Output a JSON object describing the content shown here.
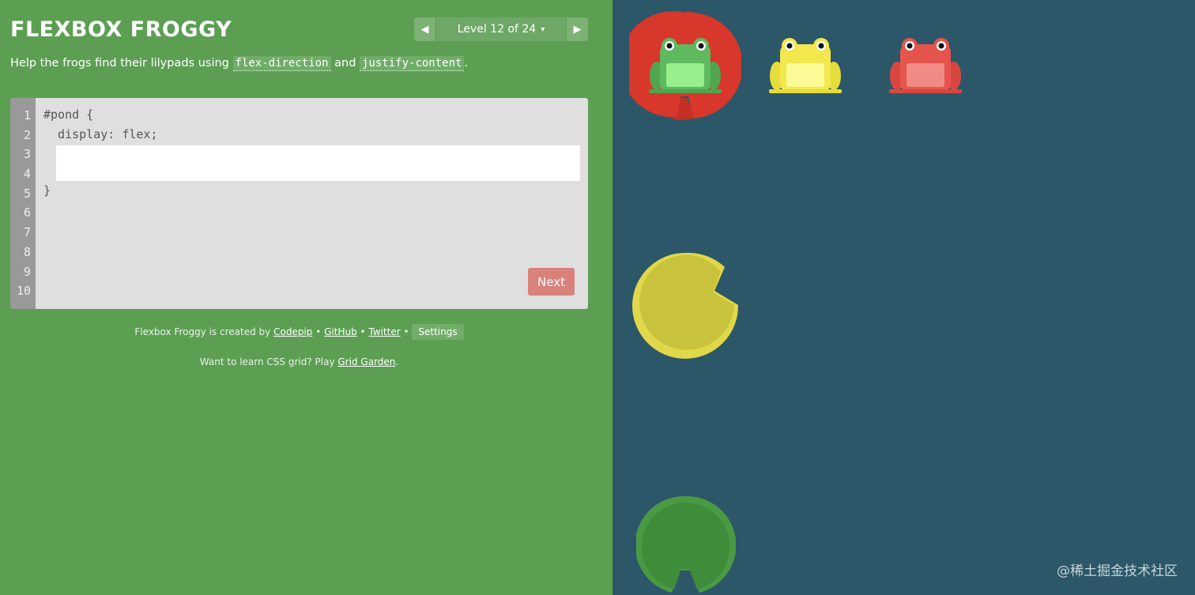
{
  "app": {
    "title": "FLEXBOX FROGGY"
  },
  "level_nav": {
    "prev_icon": "◀",
    "label": "Level 12 of 24",
    "caret_icon": "▾",
    "next_icon": "▶"
  },
  "instructions": {
    "prefix": "Help the frogs find their lilypads using ",
    "code1": "flex-direction",
    "middle": " and ",
    "code2": "justify-content",
    "suffix": "."
  },
  "editor": {
    "line_numbers": [
      "1",
      "2",
      "3",
      "4",
      "5",
      "6",
      "7",
      "8",
      "9",
      "10"
    ],
    "line1": "#pond {",
    "line2": "  display: flex;",
    "line5": "}",
    "input_value": "",
    "next_label": "Next"
  },
  "credits": {
    "prefix": "Flexbox Froggy is created by ",
    "codepip": "Codepip",
    "sep1": " • ",
    "github": "GitHub",
    "sep2": " • ",
    "twitter": "Twitter",
    "sep3": " • ",
    "settings": "Settings"
  },
  "grid_promo": {
    "prefix": "Want to learn CSS grid? Play ",
    "link": "Grid Garden",
    "suffix": "."
  },
  "board": {
    "frogs": [
      {
        "color": "green",
        "hex": "#5fb95f"
      },
      {
        "color": "yellow",
        "hex": "#f2e84e"
      },
      {
        "color": "red",
        "hex": "#e5544d"
      }
    ],
    "lilypads": [
      {
        "color": "red",
        "hex": "#d8372c"
      },
      {
        "color": "yellow",
        "hex": "#c8c23c"
      },
      {
        "color": "green",
        "hex": "#3f8c3a"
      }
    ]
  },
  "watermark": "@稀土掘金技术社区"
}
